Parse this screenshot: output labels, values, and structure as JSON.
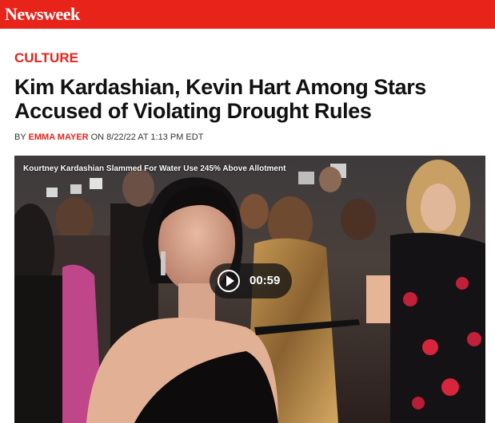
{
  "brand": {
    "logo_text": "Newsweek",
    "color": "#e8231a"
  },
  "article": {
    "section": "CULTURE",
    "headline": "Kim Kardashian, Kevin Hart Among Stars Accused of Violating Drought Rules",
    "byline_prefix": "BY",
    "author": "EMMA MAYER",
    "date_prefix": "ON",
    "date": "8/22/22 AT 1:13 PM EDT"
  },
  "video": {
    "title": "Kourtney Kardashian Slammed For Water Use 245% Above Allotment",
    "duration": "00:59",
    "play_icon": "play-icon"
  }
}
